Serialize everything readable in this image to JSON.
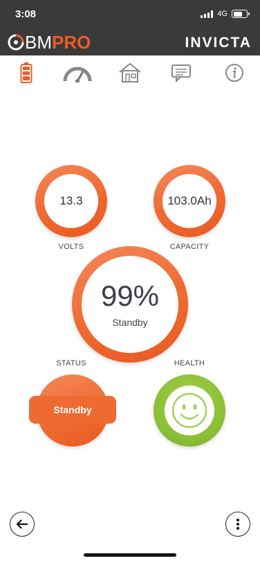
{
  "status_bar": {
    "time": "3:08",
    "network": "4G"
  },
  "brand": {
    "logo_prefix": "BM",
    "logo_suffix": "PRO",
    "product": "INVICTA",
    "accent": "#f05a28",
    "header_bg": "#3a3a3a"
  },
  "tabs": [
    {
      "icon": "battery-icon",
      "active": true
    },
    {
      "icon": "gauge-icon",
      "active": false
    },
    {
      "icon": "house-icon",
      "active": false
    },
    {
      "icon": "message-icon",
      "active": false
    },
    {
      "icon": "info-icon",
      "active": false
    }
  ],
  "gauges": {
    "volts": {
      "value": "13.3",
      "label": "VOLTS"
    },
    "capacity": {
      "value": "103.0Ah",
      "label": "CAPACITY"
    },
    "charge": {
      "value": "99%",
      "sub": "Standby"
    }
  },
  "status": {
    "label": "STATUS",
    "value": "Standby"
  },
  "health": {
    "label": "HEALTH",
    "face": "smiley-face-icon",
    "color": "#8cc037"
  },
  "controls": {
    "back": "back-arrow-icon",
    "more": "more-vertical-icon"
  }
}
